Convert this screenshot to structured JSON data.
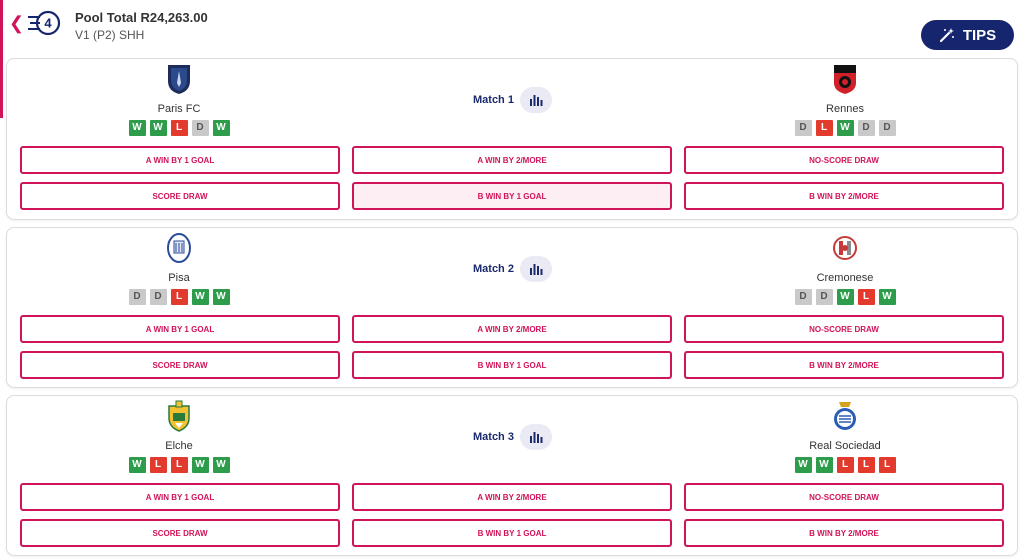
{
  "header": {
    "pool_total": "Pool Total R24,263.00",
    "subtitle": "V1 (P2) SHH",
    "tips_label": "TIPS",
    "logo_number": "4"
  },
  "colors": {
    "accent": "#d0145a",
    "navy": "#16266e",
    "win": "#2e9d4b",
    "loss": "#e23b2e",
    "draw": "#c9c9c9"
  },
  "matches": [
    {
      "label": "Match 1",
      "team_a": {
        "name": "Paris FC",
        "crest": "paris-fc-crest",
        "form": [
          "W",
          "W",
          "L",
          "D",
          "W"
        ]
      },
      "team_b": {
        "name": "Rennes",
        "crest": "rennes-crest",
        "form": [
          "D",
          "L",
          "W",
          "D",
          "D"
        ]
      },
      "options": [
        "A WIN BY 1 GOAL",
        "A WIN BY 2/MORE",
        "NO-SCORE DRAW",
        "SCORE DRAW",
        "B WIN BY 1 GOAL",
        "B WIN BY 2/MORE"
      ],
      "selected": 4
    },
    {
      "label": "Match 2",
      "team_a": {
        "name": "Pisa",
        "crest": "pisa-crest",
        "form": [
          "D",
          "D",
          "L",
          "W",
          "W"
        ]
      },
      "team_b": {
        "name": "Cremonese",
        "crest": "cremonese-crest",
        "form": [
          "D",
          "D",
          "W",
          "L",
          "W"
        ]
      },
      "options": [
        "A WIN BY 1 GOAL",
        "A WIN BY 2/MORE",
        "NO-SCORE DRAW",
        "SCORE DRAW",
        "B WIN BY 1 GOAL",
        "B WIN BY 2/MORE"
      ],
      "selected": -1
    },
    {
      "label": "Match 3",
      "team_a": {
        "name": "Elche",
        "crest": "elche-crest",
        "form": [
          "W",
          "L",
          "L",
          "W",
          "W"
        ]
      },
      "team_b": {
        "name": "Real Sociedad",
        "crest": "real-sociedad-crest",
        "form": [
          "W",
          "W",
          "L",
          "L",
          "L"
        ]
      },
      "options": [
        "A WIN BY 1 GOAL",
        "A WIN BY 2/MORE",
        "NO-SCORE DRAW",
        "SCORE DRAW",
        "B WIN BY 1 GOAL",
        "B WIN BY 2/MORE"
      ],
      "selected": -1
    }
  ]
}
